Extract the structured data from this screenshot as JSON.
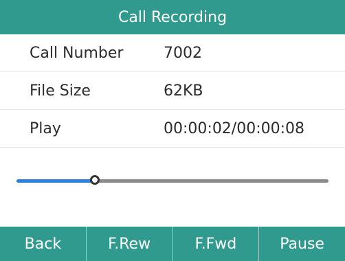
{
  "title": "Call Recording",
  "rows": [
    {
      "label": "Call Number",
      "value": "7002"
    },
    {
      "label": "File Size",
      "value": "62KB"
    },
    {
      "label": "Play",
      "value": "00:00:02/00:00:08"
    }
  ],
  "playback": {
    "progress_fraction": 0.25
  },
  "softkeys": [
    {
      "label": "Back"
    },
    {
      "label": "F.Rew"
    },
    {
      "label": "F.Fwd"
    },
    {
      "label": "Pause"
    }
  ],
  "colors": {
    "accent": "#2f9a8d",
    "progress_fill": "#2f7fdf",
    "progress_track": "#8a8a8a"
  }
}
